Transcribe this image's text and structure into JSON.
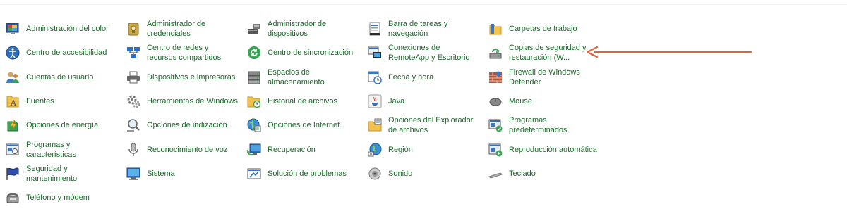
{
  "control_panel": {
    "items": [
      {
        "label": "Administración del color",
        "icon": "color-management-icon"
      },
      {
        "label": "Administrador de credenciales",
        "icon": "credential-manager-icon"
      },
      {
        "label": "Administrador de dispositivos",
        "icon": "device-manager-icon"
      },
      {
        "label": "Barra de tareas y navegación",
        "icon": "taskbar-icon"
      },
      {
        "label": "Carpetas de trabajo",
        "icon": "work-folders-icon"
      },
      {
        "label": "Centro de accesibilidad",
        "icon": "accessibility-icon"
      },
      {
        "label": "Centro de redes y recursos compartidos",
        "icon": "network-icon"
      },
      {
        "label": "Centro de sincronización",
        "icon": "sync-icon"
      },
      {
        "label": "Conexiones de RemoteApp y Escritorio",
        "icon": "remoteapp-icon"
      },
      {
        "label": "Copias de seguridad y restauración (W...",
        "icon": "backup-restore-icon"
      },
      {
        "label": "Cuentas de usuario",
        "icon": "user-accounts-icon"
      },
      {
        "label": "Dispositivos e impresoras",
        "icon": "printer-icon"
      },
      {
        "label": "Espacios de almacenamiento",
        "icon": "storage-spaces-icon"
      },
      {
        "label": "Fecha y hora",
        "icon": "date-time-icon"
      },
      {
        "label": "Firewall de Windows Defender",
        "icon": "firewall-icon"
      },
      {
        "label": "Fuentes",
        "icon": "fonts-icon"
      },
      {
        "label": "Herramientas de Windows",
        "icon": "windows-tools-icon"
      },
      {
        "label": "Historial de archivos",
        "icon": "file-history-icon"
      },
      {
        "label": "Java",
        "icon": "java-icon"
      },
      {
        "label": "Mouse",
        "icon": "mouse-icon"
      },
      {
        "label": "Opciones de energía",
        "icon": "power-options-icon"
      },
      {
        "label": "Opciones de indización",
        "icon": "indexing-icon"
      },
      {
        "label": "Opciones de Internet",
        "icon": "internet-options-icon"
      },
      {
        "label": "Opciones del Explorador de archivos",
        "icon": "explorer-options-icon"
      },
      {
        "label": "Programas predeterminados",
        "icon": "default-programs-icon"
      },
      {
        "label": "Programas y características",
        "icon": "programs-features-icon"
      },
      {
        "label": "Reconocimiento de voz",
        "icon": "microphone-icon"
      },
      {
        "label": "Recuperación",
        "icon": "recovery-icon"
      },
      {
        "label": "Región",
        "icon": "region-icon"
      },
      {
        "label": "Reproducción automática",
        "icon": "autoplay-icon"
      },
      {
        "label": "Seguridad y mantenimiento",
        "icon": "security-flag-icon"
      },
      {
        "label": "Sistema",
        "icon": "system-icon"
      },
      {
        "label": "Solución de problemas",
        "icon": "troubleshooting-icon"
      },
      {
        "label": "Sonido",
        "icon": "sound-icon"
      },
      {
        "label": "Teclado",
        "icon": "keyboard-icon"
      },
      {
        "label": "Teléfono y módem",
        "icon": "phone-modem-icon"
      }
    ]
  },
  "annotation": {
    "arrow_color": "#e0643a",
    "target": "Copias de seguridad y restauración (W..."
  },
  "colors": {
    "link_text": "#1d6a2d",
    "background": "#ffffff"
  }
}
